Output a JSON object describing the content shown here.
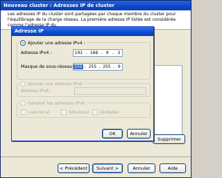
{
  "wizard": {
    "title": "Nouveau cluster : Adresses IP de cluster",
    "description": "Les adresses IP du cluster sont partagées par chaque membre du cluster pour l'équilibrage de la charge réseau. La première adresse IP listée est considérée comme l'adresse IP du",
    "remove_label": "Supprimer",
    "back_label": "< Précédent",
    "next_label": "Suivant >",
    "cancel_label": "Annuler",
    "help_label": "Aide"
  },
  "dialog": {
    "title": "Adresse IP",
    "ipv4_radio_label": "Ajouter une adresse IPv4 :",
    "ipv4_label": "Adresse IPv4 :",
    "ipv4_octets": [
      "192",
      "168",
      "0",
      "3"
    ],
    "mask_label": "Masque de sous-réseau :",
    "mask_octets": [
      "255",
      "255",
      "255",
      "0"
    ],
    "ipv6_radio_label": "Ajouter une adresse IPv6 :",
    "ipv6_label": "Adresse IPv6 :",
    "ipv6_value": "",
    "gen_radio_label": "Générer les adresses IPv6 :",
    "chk_link_local": "Lien-local",
    "chk_site_local": "Site-local",
    "chk_global": "Globales",
    "ok_label": "OK",
    "cancel_label": "Annuler"
  }
}
